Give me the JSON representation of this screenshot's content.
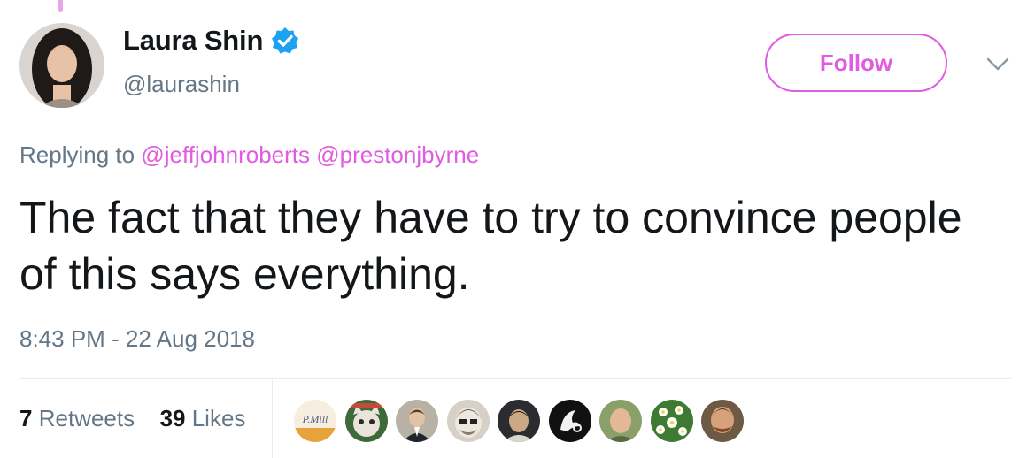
{
  "tweet": {
    "author": {
      "display_name": "Laura Shin",
      "handle": "@laurashin",
      "verified": true
    },
    "follow_label": "Follow",
    "replying": {
      "prefix": "Replying to",
      "mentions": [
        "@jeffjohnroberts",
        "@prestonjbyrne"
      ]
    },
    "text": "The fact that they have to try to convince people of this says everything.",
    "timestamp": "8:43 PM - 22 Aug 2018",
    "stats": {
      "retweets_count": "7",
      "retweets_label": "Retweets",
      "likes_count": "39",
      "likes_label": "Likes"
    },
    "likers_avatar_text": "P.Mill"
  },
  "colors": {
    "accent": "#e05ce0",
    "verified_blue": "#1da1f2",
    "secondary_text": "#657786",
    "primary_text": "#14171a"
  },
  "icons": [
    "verified-badge-icon",
    "chevron-down-icon"
  ]
}
